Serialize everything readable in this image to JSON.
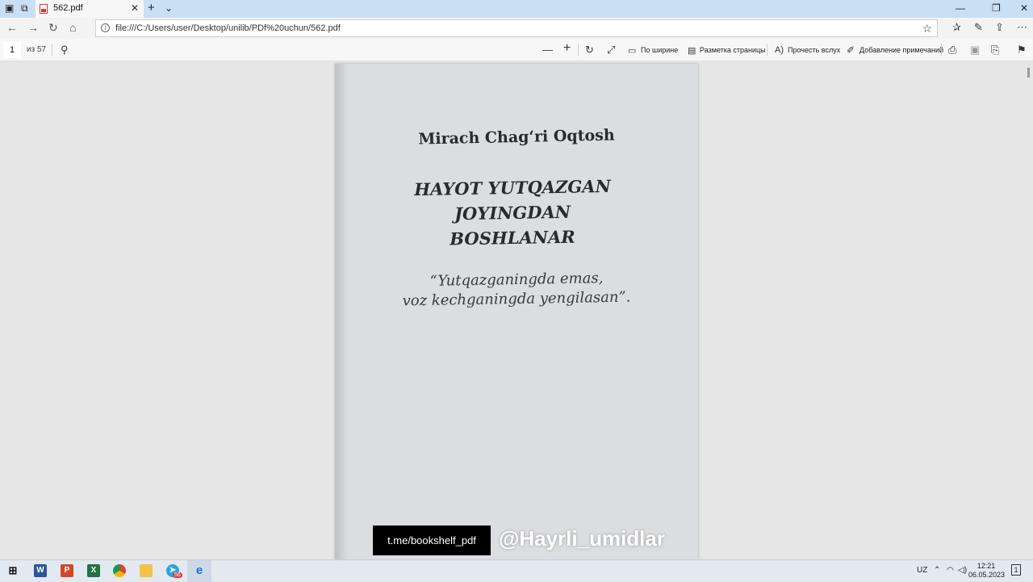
{
  "browser": {
    "tab_title": "562.pdf",
    "url": "file:///C:/Users/user/Desktop/unilib/PDf%20uchun/562.pdf"
  },
  "pdf_toolbar": {
    "page_number": "1",
    "page_count": "из 57",
    "fit_width_label": "По ширине",
    "page_layout_label": "Разметка страницы",
    "read_aloud_label": "Прочесть вслух",
    "add_notes_label": "Добавление примечаний"
  },
  "document": {
    "author": "Mirach Chag‘ri Oqtosh",
    "title_lines": [
      "HAYOT YUTQAZGAN",
      "JOYINGDAN",
      "BOSHLANAR"
    ],
    "quote_lines": [
      "“Yutqazganingda emas,",
      "voz kechganingda yengilasan”."
    ],
    "watermark_link": "t.me/bookshelf_pdf",
    "watermark_handle": "@Hayrli_umidlar"
  },
  "taskbar": {
    "language": "UZ",
    "time": "12:21",
    "date": "06.05.2023",
    "notification_count": "1",
    "telegram_badge": "56"
  }
}
